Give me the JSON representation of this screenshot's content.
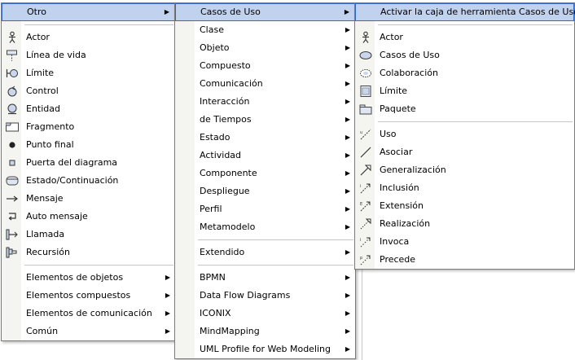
{
  "menu1": {
    "header": "Otro",
    "elements": [
      {
        "label": "Actor",
        "icon": "actor-icon"
      },
      {
        "label": "Línea de vida",
        "icon": "lifeline-icon"
      },
      {
        "label": "Límite",
        "icon": "boundary-icon"
      },
      {
        "label": "Control",
        "icon": "control-icon"
      },
      {
        "label": "Entidad",
        "icon": "entity-icon"
      },
      {
        "label": "Fragmento",
        "icon": "fragment-icon"
      },
      {
        "label": "Punto final",
        "icon": "endpoint-icon"
      },
      {
        "label": "Puerta del diagrama",
        "icon": "diagram-gate-icon"
      },
      {
        "label": "Estado/Continuación",
        "icon": "state-continuation-icon"
      },
      {
        "label": "Mensaje",
        "icon": "message-arrow-icon"
      },
      {
        "label": "Auto mensaje",
        "icon": "self-message-icon"
      },
      {
        "label": "Llamada",
        "icon": "call-icon"
      },
      {
        "label": "Recursión",
        "icon": "recursion-icon"
      }
    ],
    "submenus": [
      "Elementos de objetos",
      "Elementos compuestos",
      "Elementos de comunicación",
      "Común"
    ]
  },
  "menu2": {
    "header": "Casos de Uso",
    "group1": [
      "Clase",
      "Objeto",
      "Compuesto",
      "Comunicación",
      "Interacción",
      "de Tiempos",
      "Estado",
      "Actividad",
      "Componente",
      "Despliegue",
      "Perfil",
      "Metamodelo"
    ],
    "group2": [
      "Extendido"
    ],
    "group3": [
      "BPMN",
      "Data Flow Diagrams",
      "ICONIX",
      "MindMapping",
      "UML Profile for Web Modeling"
    ]
  },
  "menu3": {
    "header": "Activar la caja de herramienta Casos de Uso",
    "elements": [
      {
        "label": "Actor",
        "icon": "actor-icon"
      },
      {
        "label": "Casos de Uso",
        "icon": "use-case-ellipse-icon"
      },
      {
        "label": "Colaboración",
        "icon": "collaboration-icon"
      },
      {
        "label": "Límite",
        "icon": "boundary-box-icon"
      },
      {
        "label": "Paquete",
        "icon": "package-icon"
      }
    ],
    "relations": [
      {
        "label": "Uso",
        "icon": "use-relation-icon"
      },
      {
        "label": "Asociar",
        "icon": "associate-line-icon"
      },
      {
        "label": "Generalización",
        "icon": "generalization-arrow-icon"
      },
      {
        "label": "Inclusión",
        "icon": "include-arrow-icon"
      },
      {
        "label": "Extensión",
        "icon": "extend-arrow-icon"
      },
      {
        "label": "Realización",
        "icon": "realization-arrow-icon"
      },
      {
        "label": "Invoca",
        "icon": "invokes-arrow-icon"
      },
      {
        "label": "Precede",
        "icon": "precedes-arrow-icon"
      }
    ]
  },
  "colors": {
    "highlight": "#c1d2ee",
    "highlight_border": "#316ac5",
    "gutter": "#f4f4f0",
    "border": "#7a7a7a"
  }
}
